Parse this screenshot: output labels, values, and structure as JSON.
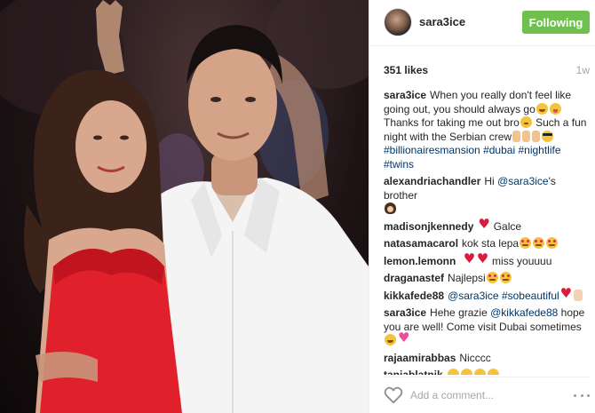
{
  "post": {
    "author": "sara3ice",
    "follow_label": "Following",
    "likes": "351 likes",
    "age": "1w",
    "add_comment_placeholder": "Add a comment..."
  },
  "caption": {
    "user": "sara3ice",
    "text_1": "When you really don't feel like going out, you should always go",
    "text_2": "Thanks for taking me out bro",
    "text_3": "Such a fun night with the Serbian crew",
    "hashtags": [
      "#billionairesmansion",
      "#dubai",
      "#nightlife",
      "#twins"
    ]
  },
  "comments": [
    {
      "user": "alexandriachandler",
      "pre": "Hi ",
      "mention": "@sara3ice",
      "post": "'s brother"
    },
    {
      "user": "madisonjkennedy",
      "text": "Galce"
    },
    {
      "user": "natasamacarol",
      "text": "kok sta lepa"
    },
    {
      "user": "lemon.lemonn",
      "text": "miss youuuu"
    },
    {
      "user": "draganastef",
      "text": "Najlepsi"
    },
    {
      "user": "kikkafede88",
      "mention": "@sara3ice",
      "tag": "#sobeautiful"
    },
    {
      "user": "sara3ice",
      "pre": "Hehe grazie ",
      "mention": "@kikkafede88",
      "post": " hope you are well! Come visit Dubai sometimes"
    },
    {
      "user": "rajaamirabbas",
      "text": "Nicccc"
    },
    {
      "user": "tanjablatnik",
      "text": ""
    }
  ],
  "colors": {
    "follow_green": "#70c050",
    "link_blue": "#003569",
    "muted_gray": "#a5a7aa"
  },
  "icons": {
    "like": "heart-outline-icon",
    "more": "more-options-icon"
  }
}
